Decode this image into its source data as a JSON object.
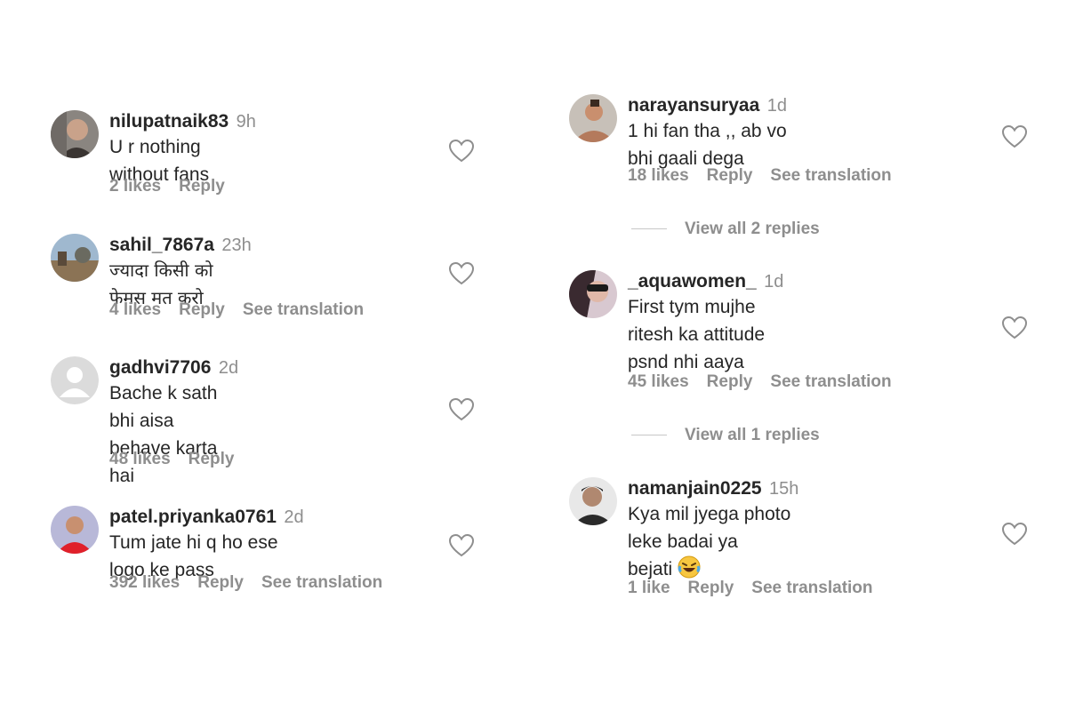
{
  "comments_left": [
    {
      "username": "nilupatnaik83",
      "time": "9h",
      "text": "U r nothing without fans",
      "likes": "2 likes",
      "reply": "Reply",
      "translation": ""
    },
    {
      "username": "sahil_7867a",
      "time": "23h",
      "text": "ज्यादा किसी को फेमस मत करो",
      "likes": "4 likes",
      "reply": "Reply",
      "translation": "See translation"
    },
    {
      "username": "gadhvi7706",
      "time": "2d",
      "text_line1": "Bache k sath bhi aisa behave karta",
      "text_line2": "hai",
      "likes": "48 likes",
      "reply": "Reply",
      "translation": ""
    },
    {
      "username": "patel.priyanka0761",
      "time": "2d",
      "text": "Tum jate hi q ho ese logo ke pass",
      "likes": "392 likes",
      "reply": "Reply",
      "translation": "See translation"
    }
  ],
  "comments_right": [
    {
      "username": "narayansuryaa",
      "time": "1d",
      "text": "1 hi fan tha ,, ab vo bhi gaali dega",
      "likes": "18 likes",
      "reply": "Reply",
      "translation": "See translation",
      "view_replies": "View all 2 replies"
    },
    {
      "username": "_aquawomen_",
      "time": "1d",
      "text_line1": "First tym mujhe ritesh ka attitude",
      "text_line2": "psnd nhi aaya",
      "likes": "45 likes",
      "reply": "Reply",
      "translation": "See translation",
      "view_replies": "View all 1 replies"
    },
    {
      "username": "namanjain0225",
      "time": "15h",
      "text_line1": "Kya mil jyega photo leke badai ya",
      "text_line2": "bejati",
      "emoji": "laughing-tears-emoji",
      "likes": "1 like",
      "reply": "Reply",
      "translation": "See translation"
    }
  ],
  "icons": {
    "like": "heart-outline-icon",
    "default_avatar": "default-user-icon"
  },
  "colors": {
    "text": "#262626",
    "secondary": "#8e8e8e",
    "background": "#ffffff"
  }
}
